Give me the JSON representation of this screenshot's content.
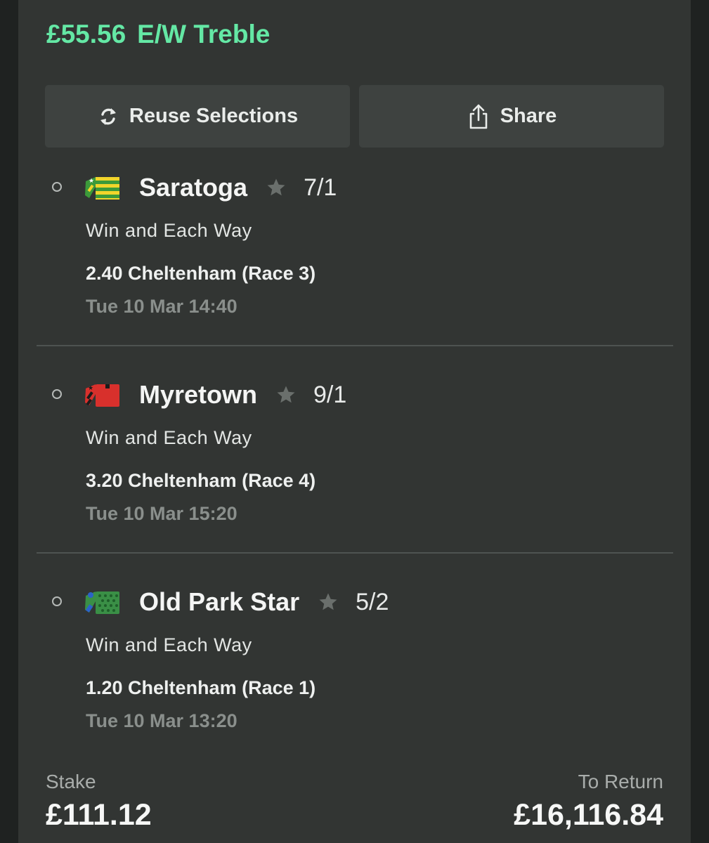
{
  "bet": {
    "stake_amount": "£55.56",
    "bet_type": "E/W Treble"
  },
  "actions": {
    "reuse_label": "Reuse Selections",
    "share_label": "Share"
  },
  "selections": [
    {
      "runner": "Saratoga",
      "odds": "7/1",
      "market": "Win and Each Way",
      "event": "2.40 Cheltenham (Race 3)",
      "date": "Tue 10 Mar 14:40",
      "silks_colors": [
        "#f1d52b",
        "#3c9a3a"
      ]
    },
    {
      "runner": "Myretown",
      "odds": "9/1",
      "market": "Win and Each Way",
      "event": "3.20 Cheltenham (Race 4)",
      "date": "Tue 10 Mar 15:20",
      "silks_colors": [
        "#d8302c",
        "#1b1b1b"
      ]
    },
    {
      "runner": "Old Park Star",
      "odds": "5/2",
      "market": "Win and Each Way",
      "event": "1.20 Cheltenham (Race 1)",
      "date": "Tue 10 Mar 13:20",
      "silks_colors": [
        "#3a8f46",
        "#2b63c7"
      ]
    }
  ],
  "summary": {
    "stake_label": "Stake",
    "stake_value": "£111.12",
    "return_label": "To Return",
    "return_value": "£16,116.84"
  },
  "theme": {
    "accent": "#64e8a5",
    "background": "#323533",
    "button_bg": "#3e4240"
  },
  "icons": [
    "refresh-icon",
    "share-icon",
    "star-icon",
    "radio-icon",
    "silks-icon"
  ]
}
